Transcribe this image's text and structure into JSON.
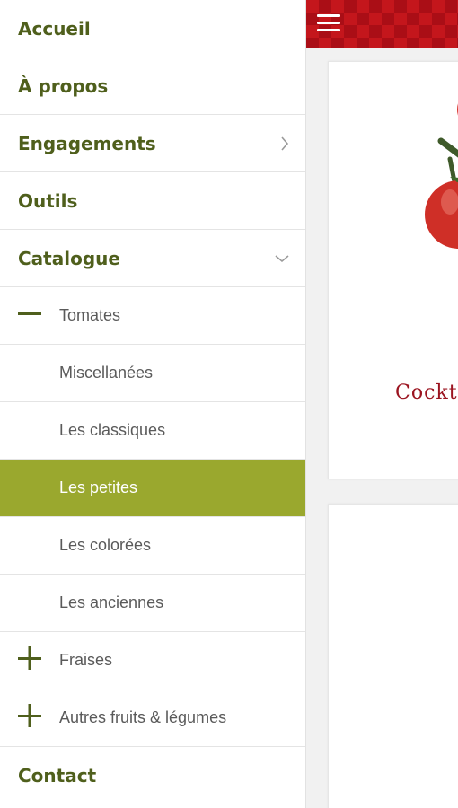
{
  "sidebar": {
    "items": [
      {
        "label": "Accueil"
      },
      {
        "label": "À propos"
      },
      {
        "label": "Engagements"
      },
      {
        "label": "Outils"
      },
      {
        "label": "Catalogue"
      },
      {
        "label": "Tomates"
      },
      {
        "label": "Miscellanées"
      },
      {
        "label": "Les classiques"
      },
      {
        "label": "Les petites"
      },
      {
        "label": "Les colorées"
      },
      {
        "label": "Les anciennes"
      },
      {
        "label": "Fraises"
      },
      {
        "label": "Autres fruits & légumes"
      },
      {
        "label": "Contact"
      }
    ]
  },
  "main": {
    "card1": {
      "title": "Cockt"
    }
  },
  "colors": {
    "accent_green": "#9aa82e",
    "text_green": "#4f5f1c",
    "header_red": "#c4161c",
    "title_red": "#9b1420"
  },
  "icons": {
    "menu": "hamburger-icon",
    "expand": "chevron-right-icon",
    "collapse": "chevron-down-icon",
    "minus": "minus-icon",
    "plus": "plus-icon"
  }
}
